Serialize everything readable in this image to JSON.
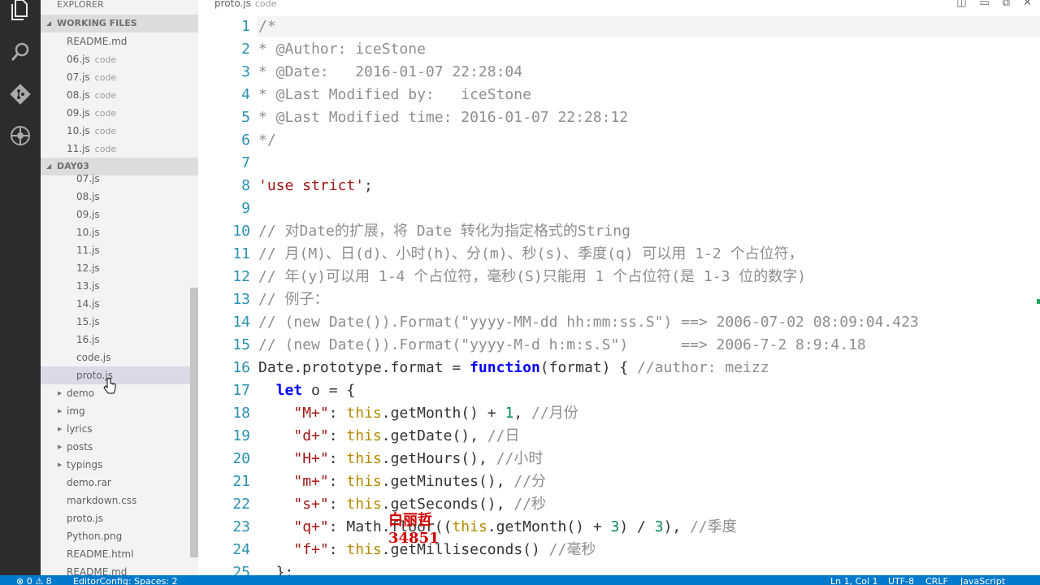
{
  "activity_bar": {
    "icons": [
      "files-icon",
      "search-icon",
      "git-icon",
      "debug-icon"
    ]
  },
  "sidebar": {
    "title": "EXPLORER",
    "working_files": {
      "header": "WORKING FILES",
      "items": [
        {
          "name": "README.md",
          "desc": ""
        },
        {
          "name": "06.js",
          "desc": "code"
        },
        {
          "name": "07.js",
          "desc": "code"
        },
        {
          "name": "08.js",
          "desc": "code"
        },
        {
          "name": "09.js",
          "desc": "code"
        },
        {
          "name": "10.js",
          "desc": "code"
        },
        {
          "name": "11.js",
          "desc": "code"
        }
      ]
    },
    "project": {
      "header": "DAY03",
      "code_files": [
        "07.js",
        "08.js",
        "09.js",
        "10.js",
        "11.js",
        "12.js",
        "13.js",
        "14.js",
        "15.js",
        "16.js",
        "code.js",
        "proto.js"
      ],
      "root_items": [
        {
          "name": "demo",
          "folder": true
        },
        {
          "name": "img",
          "folder": true
        },
        {
          "name": "lyrics",
          "folder": true
        },
        {
          "name": "posts",
          "folder": true
        },
        {
          "name": "typings",
          "folder": true
        },
        {
          "name": "demo.rar",
          "folder": false
        },
        {
          "name": "markdown.css",
          "folder": false
        },
        {
          "name": "proto.js",
          "folder": false
        },
        {
          "name": "Python.png",
          "folder": false
        },
        {
          "name": "README.html",
          "folder": false
        },
        {
          "name": "README.md",
          "folder": false
        }
      ]
    }
  },
  "editor": {
    "tab": {
      "name": "proto.js",
      "desc": "code"
    },
    "lines": [
      {
        "n": "1",
        "tokens": [
          [
            "c-com",
            "/*"
          ]
        ]
      },
      {
        "n": "2",
        "tokens": [
          [
            "c-com",
            "* @Author: iceStone"
          ]
        ]
      },
      {
        "n": "3",
        "tokens": [
          [
            "c-com",
            "* @Date:   2016-01-07 22:28:04"
          ]
        ]
      },
      {
        "n": "4",
        "tokens": [
          [
            "c-com",
            "* @Last Modified by:   iceStone"
          ]
        ]
      },
      {
        "n": "5",
        "tokens": [
          [
            "c-com",
            "* @Last Modified time: 2016-01-07 22:28:12"
          ]
        ]
      },
      {
        "n": "6",
        "tokens": [
          [
            "c-com",
            "*/"
          ]
        ]
      },
      {
        "n": "7",
        "tokens": []
      },
      {
        "n": "8",
        "tokens": [
          [
            "c-str",
            "'use strict'"
          ],
          [
            "c-op",
            ";"
          ]
        ]
      },
      {
        "n": "9",
        "tokens": []
      },
      {
        "n": "10",
        "tokens": [
          [
            "c-com",
            "// 对Date的扩展，将 Date 转化为指定格式的String"
          ]
        ]
      },
      {
        "n": "11",
        "tokens": [
          [
            "c-com",
            "// 月(M)、日(d)、小时(h)、分(m)、秒(s)、季度(q) 可以用 1-2 个占位符，"
          ]
        ]
      },
      {
        "n": "12",
        "tokens": [
          [
            "c-com",
            "// 年(y)可以用 1-4 个占位符，毫秒(S)只能用 1 个占位符(是 1-3 位的数字)"
          ]
        ]
      },
      {
        "n": "13",
        "tokens": [
          [
            "c-com",
            "// 例子："
          ]
        ]
      },
      {
        "n": "14",
        "tokens": [
          [
            "c-com",
            "// (new Date()).Format(\"yyyy-MM-dd hh:mm:ss.S\") ==> 2006-07-02 08:09:04.423"
          ]
        ]
      },
      {
        "n": "15",
        "tokens": [
          [
            "c-com",
            "// (new Date()).Format(\"yyyy-M-d h:m:s.S\")      ==> 2006-7-2 8:9:4.18"
          ]
        ]
      },
      {
        "n": "16",
        "tokens": [
          [
            "c-op",
            "Date.prototype.format = "
          ],
          [
            "c-kw",
            "function"
          ],
          [
            "c-op",
            "(format) { "
          ],
          [
            "c-com",
            "//author: meizz"
          ]
        ]
      },
      {
        "n": "17",
        "tokens": [
          [
            "c-op",
            "  "
          ],
          [
            "c-kw",
            "let"
          ],
          [
            "c-op",
            " o = {"
          ]
        ]
      },
      {
        "n": "18",
        "tokens": [
          [
            "c-op",
            "    "
          ],
          [
            "c-str",
            "\"M+\""
          ],
          [
            "c-op",
            ": "
          ],
          [
            "c-this",
            "this"
          ],
          [
            "c-op",
            ".getMonth() + "
          ],
          [
            "c-num",
            "1"
          ],
          [
            "c-op",
            ", "
          ],
          [
            "c-com",
            "//月份"
          ]
        ]
      },
      {
        "n": "19",
        "tokens": [
          [
            "c-op",
            "    "
          ],
          [
            "c-str",
            "\"d+\""
          ],
          [
            "c-op",
            ": "
          ],
          [
            "c-this",
            "this"
          ],
          [
            "c-op",
            ".getDate(), "
          ],
          [
            "c-com",
            "//日"
          ]
        ]
      },
      {
        "n": "20",
        "tokens": [
          [
            "c-op",
            "    "
          ],
          [
            "c-str",
            "\"H+\""
          ],
          [
            "c-op",
            ": "
          ],
          [
            "c-this",
            "this"
          ],
          [
            "c-op",
            ".getHours(), "
          ],
          [
            "c-com",
            "//小时"
          ]
        ]
      },
      {
        "n": "21",
        "tokens": [
          [
            "c-op",
            "    "
          ],
          [
            "c-str",
            "\"m+\""
          ],
          [
            "c-op",
            ": "
          ],
          [
            "c-this",
            "this"
          ],
          [
            "c-op",
            ".getMinutes(), "
          ],
          [
            "c-com",
            "//分"
          ]
        ]
      },
      {
        "n": "22",
        "tokens": [
          [
            "c-op",
            "    "
          ],
          [
            "c-str",
            "\"s+\""
          ],
          [
            "c-op",
            ": "
          ],
          [
            "c-this",
            "this"
          ],
          [
            "c-op",
            ".getSeconds(), "
          ],
          [
            "c-com",
            "//秒"
          ]
        ]
      },
      {
        "n": "23",
        "tokens": [
          [
            "c-op",
            "    "
          ],
          [
            "c-str",
            "\"q+\""
          ],
          [
            "c-op",
            ": Math.floor(("
          ],
          [
            "c-this",
            "this"
          ],
          [
            "c-op",
            ".getMonth() + "
          ],
          [
            "c-num",
            "3"
          ],
          [
            "c-op",
            ") / "
          ],
          [
            "c-num",
            "3"
          ],
          [
            "c-op",
            "), "
          ],
          [
            "c-com",
            "//季度"
          ]
        ]
      },
      {
        "n": "24",
        "tokens": [
          [
            "c-op",
            "    "
          ],
          [
            "c-str",
            "\"f+\""
          ],
          [
            "c-op",
            ": "
          ],
          [
            "c-this",
            "this"
          ],
          [
            "c-op",
            ".getMilliseconds() "
          ],
          [
            "c-com",
            "//毫秒"
          ]
        ]
      },
      {
        "n": "25",
        "tokens": [
          [
            "c-op",
            "  };"
          ]
        ]
      }
    ]
  },
  "watermark": {
    "name": "白丽哲",
    "number": "34851"
  },
  "statusbar": {
    "problems": "⊗ 0  ⚠ 8",
    "editorconfig": "EditorConfig: Spaces: 2",
    "position": "Ln 1, Col 1",
    "encoding": "UTF-8",
    "eol": "CRLF",
    "language": "JavaScript"
  },
  "colors": {
    "accent": "#007acc",
    "activity_bar": "#2c2c2c",
    "sidebar": "#f3f3f3"
  }
}
